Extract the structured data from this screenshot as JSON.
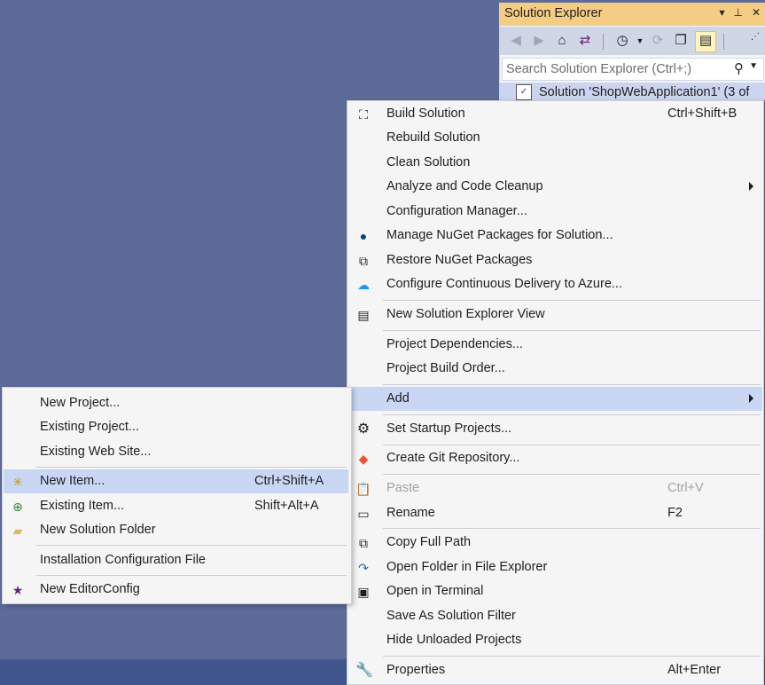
{
  "solution_explorer": {
    "title": "Solution Explorer",
    "title_buttons": [
      "▾",
      "⊥",
      "✕"
    ],
    "search_placeholder": "Search Solution Explorer (Ctrl+;)",
    "tree_item": "Solution 'ShopWebApplication1' (3 of"
  },
  "main_menu": {
    "items": [
      {
        "label": "Build Solution",
        "shortcut": "Ctrl+Shift+B"
      },
      {
        "label": "Rebuild Solution"
      },
      {
        "label": "Clean Solution"
      },
      {
        "label": "Analyze and Code Cleanup"
      },
      {
        "label": "Configuration Manager..."
      },
      {
        "label": "Manage NuGet Packages for Solution..."
      },
      {
        "label": "Restore NuGet Packages"
      },
      {
        "label": "Configure Continuous Delivery to Azure..."
      },
      {
        "label": "New Solution Explorer View"
      },
      {
        "label": "Project Dependencies..."
      },
      {
        "label": "Project Build Order..."
      },
      {
        "label": "Add"
      },
      {
        "label": "Set Startup Projects..."
      },
      {
        "label": "Create Git Repository..."
      },
      {
        "label": "Paste",
        "shortcut": "Ctrl+V"
      },
      {
        "label": "Rename",
        "shortcut": "F2"
      },
      {
        "label": "Copy Full Path"
      },
      {
        "label": "Open Folder in File Explorer"
      },
      {
        "label": "Open in Terminal"
      },
      {
        "label": "Save As Solution Filter"
      },
      {
        "label": "Hide Unloaded Projects"
      },
      {
        "label": "Properties",
        "shortcut": "Alt+Enter"
      }
    ]
  },
  "add_submenu": {
    "items": [
      {
        "label": "New Project..."
      },
      {
        "label": "Existing Project..."
      },
      {
        "label": "Existing Web Site..."
      },
      {
        "label": "New Item...",
        "shortcut": "Ctrl+Shift+A"
      },
      {
        "label": "Existing Item...",
        "shortcut": "Shift+Alt+A"
      },
      {
        "label": "New Solution Folder"
      },
      {
        "label": "Installation Configuration File"
      },
      {
        "label": "New EditorConfig"
      }
    ]
  },
  "colors": {
    "background": "#5d6b99",
    "title_accent": "#f5cc84",
    "highlight": "#c9d7f5"
  }
}
